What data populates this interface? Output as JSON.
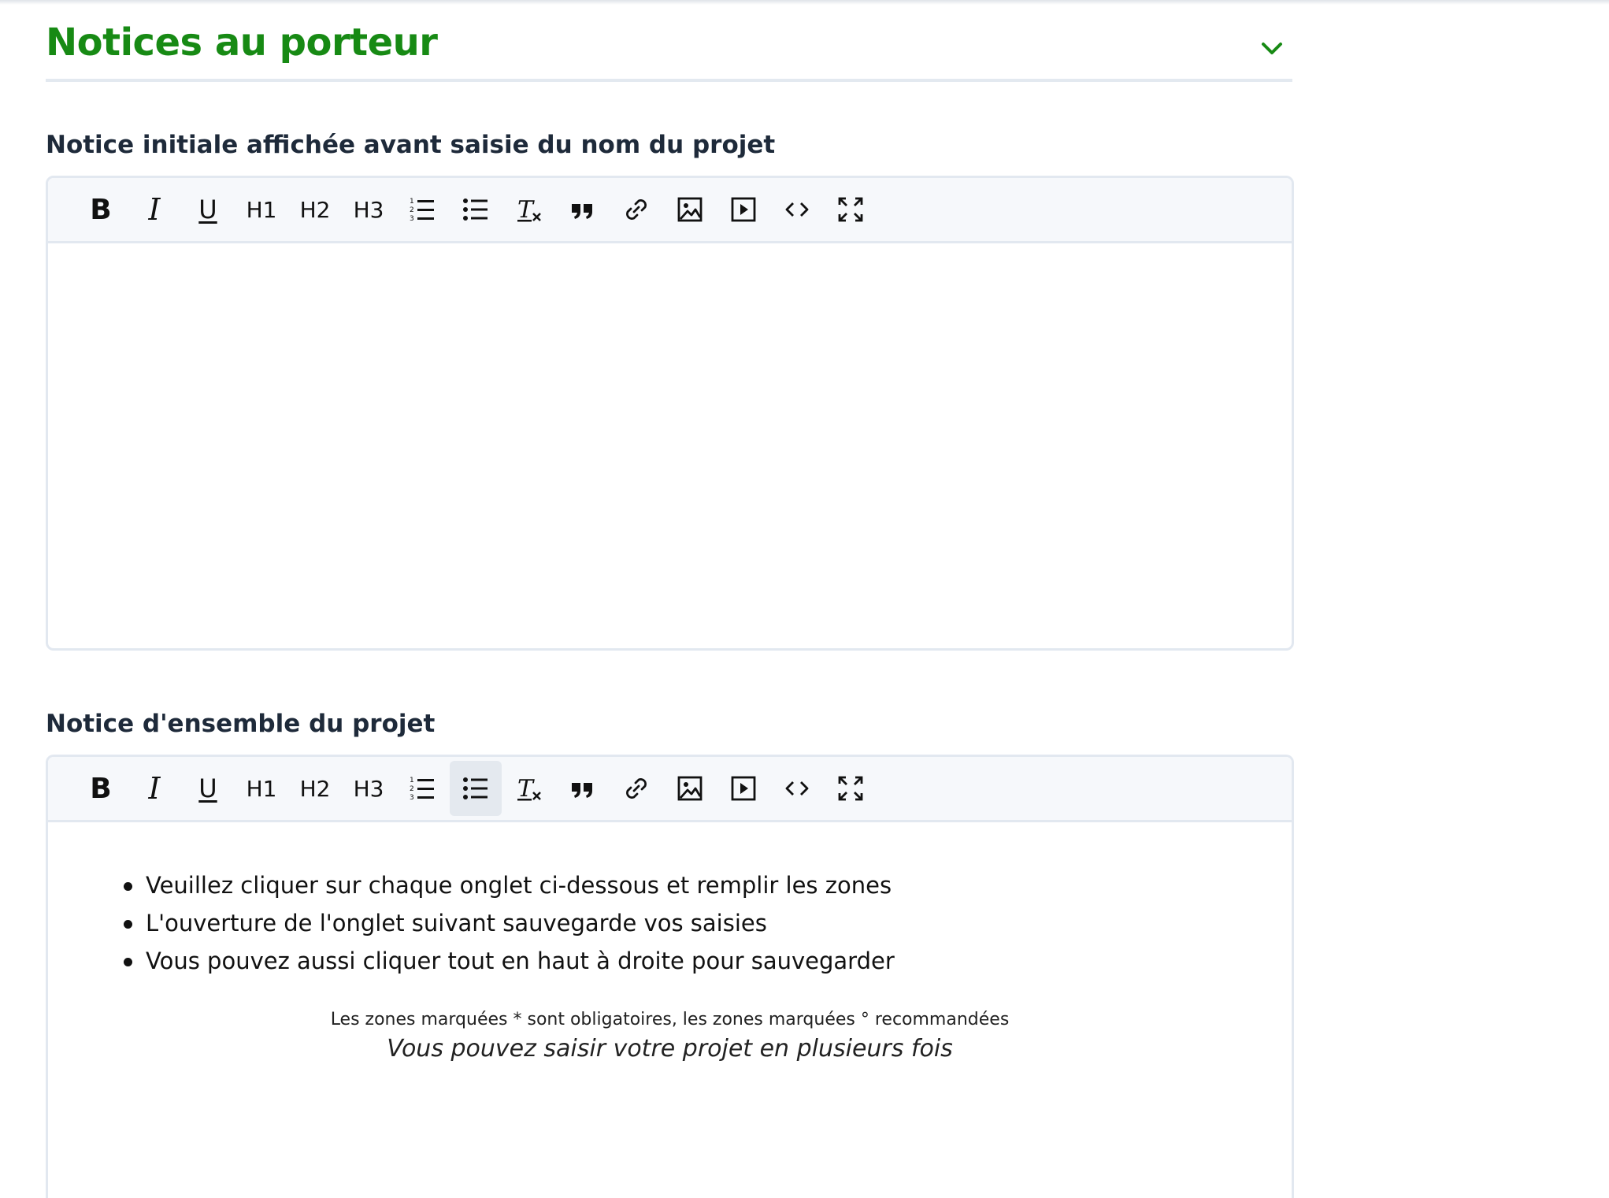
{
  "section": {
    "title": "Notices au porteur"
  },
  "toolbar_items": {
    "bold": "B",
    "italic": "I",
    "underline": "U",
    "h1": "H1",
    "h2": "H2",
    "h3": "H3"
  },
  "toolbar_icons": [
    "bold-icon",
    "italic-icon",
    "underline-icon",
    "h1",
    "h2",
    "h3",
    "ordered-list-icon",
    "bullet-list-icon",
    "clear-format-icon",
    "quote-icon",
    "link-icon",
    "image-icon",
    "video-icon",
    "code-icon",
    "fullscreen-icon"
  ],
  "editor1": {
    "label": "Notice initiale affichée avant saisie du nom du projet",
    "content": ""
  },
  "editor2": {
    "label": "Notice d'ensemble du projet",
    "bullets": [
      "Veuillez cliquer sur chaque onglet ci-dessous et remplir les zones",
      "L'ouverture de l'onglet suivant sauvegarde vos saisies",
      "Vous pouvez aussi cliquer tout en haut à droite pour sauvegarder"
    ],
    "note_small": "Les zones marquées * sont obligatoires, les zones marquées ° recommandées",
    "note_italic": "Vous pouvez saisir votre projet en plusieurs fois"
  },
  "colors": {
    "accent": "#178a14",
    "border": "#e2e8f0",
    "toolbar_bg": "#f6f8fb"
  }
}
